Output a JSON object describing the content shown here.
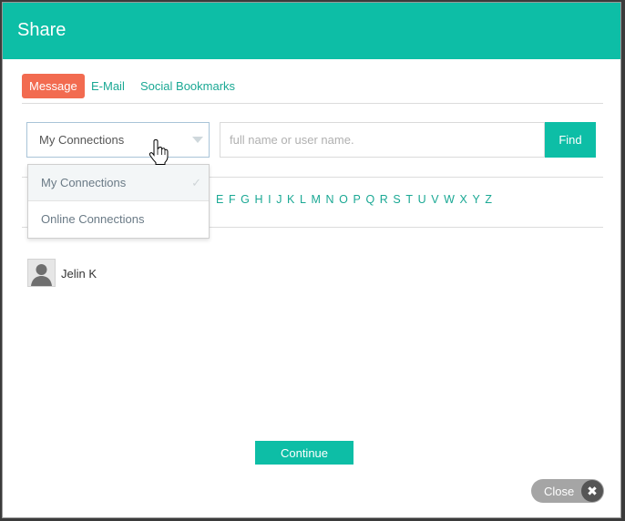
{
  "dialog": {
    "title": "Share"
  },
  "tabs": [
    {
      "label": "Message",
      "active": true
    },
    {
      "label": "E-Mail",
      "active": false
    },
    {
      "label": "Social Bookmarks",
      "active": false
    }
  ],
  "filter": {
    "selected": "My Connections",
    "options": [
      "My Connections",
      "Online Connections"
    ]
  },
  "search": {
    "placeholder": "full name or user name.",
    "value": "",
    "button_label": "Find"
  },
  "alphabet_visible": [
    "E",
    "F",
    "G",
    "H",
    "I",
    "J",
    "K",
    "L",
    "M",
    "N",
    "O",
    "P",
    "Q",
    "R",
    "S",
    "T",
    "U",
    "V",
    "W",
    "X",
    "Y",
    "Z"
  ],
  "contacts": [
    {
      "name": "Jelin K"
    }
  ],
  "footer": {
    "continue_label": "Continue",
    "close_label": "Close",
    "close_icon": "✖"
  },
  "icons": {
    "dropdown_caret": "chevron-down-icon",
    "check": "check-icon",
    "cursor": "hand-cursor-icon",
    "avatar": "user-silhouette-icon"
  },
  "colors": {
    "accent": "#0dbea6",
    "active_tab": "#f26b50",
    "link": "#1aa894"
  }
}
